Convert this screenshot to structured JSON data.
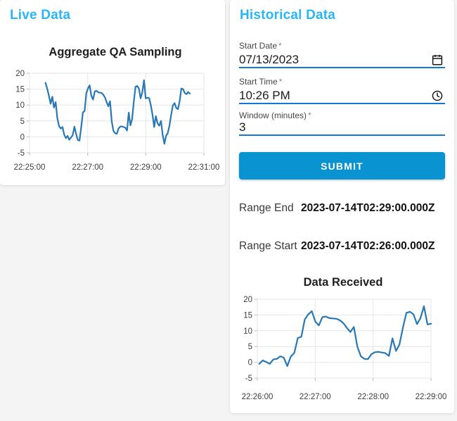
{
  "theme": {
    "accent_blue": "#29b6f6",
    "submit_blue": "#0994d1",
    "underline_blue": "#1079d8",
    "line_blue": "#2878b5"
  },
  "live_panel": {
    "title": "Live Data"
  },
  "historical_panel": {
    "title": "Historical Data",
    "form": {
      "required_marker": "*",
      "start_date": {
        "label": "Start Date",
        "value": "07/13/2023",
        "icon": "calendar-icon"
      },
      "start_time": {
        "label": "Start Time",
        "value": "10:26 PM",
        "icon": "clock-icon"
      },
      "window_minutes": {
        "label": "Window (minutes)",
        "value": "3"
      },
      "submit_label": "SUBMIT"
    },
    "results": {
      "range_end_label": "Range End",
      "range_end_value": "2023-07-14T02:29:00.000Z",
      "range_start_label": "Range Start",
      "range_start_value": "2023-07-14T02:26:00.000Z"
    }
  },
  "chart_data": [
    {
      "type": "line",
      "title": "Aggregate QA Sampling",
      "x_tick_labels": [
        "22:25:00",
        "22:27:00",
        "22:29:00",
        "22:31:00"
      ],
      "x_axis_seconds": 360,
      "data_start_seconds": 33,
      "data_end_seconds": 331,
      "ylim": [
        -5,
        20
      ],
      "y_ticks": [
        20,
        15,
        10,
        5,
        0,
        -5
      ],
      "grid": true,
      "legend": "none",
      "line_color": "#2878b5",
      "values": [
        17.0,
        15.2,
        12.9,
        10.4,
        12.6,
        9.2,
        10.9,
        5.8,
        3.3,
        2.6,
        3.1,
        0.7,
        -0.4,
        0.3,
        -0.9,
        -0.2,
        0.5,
        3.2,
        1.0,
        -1.0,
        -1.2,
        3.0,
        7.7,
        8.1,
        13.6,
        15.2,
        16.2,
        12.9,
        11.7,
        14.3,
        14.5,
        14.0,
        13.9,
        13.8,
        13.3,
        12.4,
        10.9,
        9.6,
        11.2,
        4.9,
        1.9,
        1.1,
        1.0,
        2.6,
        3.2,
        3.3,
        3.1,
        2.9,
        2.0,
        7.6,
        3.6,
        5.6,
        11.0,
        15.7,
        16.0,
        15.2,
        12.1,
        14.0,
        17.8,
        12.1,
        12.3,
        12.2,
        10.0,
        7.0,
        3.1,
        6.5,
        4.3,
        3.5,
        5.0,
        0.6,
        -2.2,
        0.3,
        1.2,
        3.5,
        7.0,
        9.9,
        10.6,
        9.1,
        8.7,
        11.2,
        15.2,
        15.0,
        13.8,
        13.4,
        14.1,
        13.6
      ]
    },
    {
      "type": "line",
      "title": "Data Received",
      "x_tick_labels": [
        "22:26:00",
        "22:27:00",
        "22:28:00",
        "22:29:00"
      ],
      "x_axis_seconds": 180,
      "data_start_seconds": 2,
      "data_end_seconds": 180,
      "ylim": [
        -5,
        20
      ],
      "y_ticks": [
        20,
        15,
        10,
        5,
        0,
        -5
      ],
      "grid": true,
      "legend": "none",
      "line_color": "#2878b5",
      "values": [
        -0.5,
        0.6,
        0.1,
        -0.5,
        0.9,
        1.1,
        1.9,
        1.5,
        -1.2,
        1.8,
        3.0,
        7.7,
        8.1,
        13.6,
        15.2,
        16.2,
        12.9,
        11.7,
        14.3,
        14.5,
        14.0,
        13.9,
        13.8,
        13.3,
        12.4,
        10.9,
        9.6,
        11.2,
        4.9,
        1.9,
        1.1,
        1.0,
        2.6,
        3.2,
        3.3,
        3.1,
        2.9,
        2.0,
        7.6,
        3.6,
        5.6,
        11.0,
        15.7,
        16.0,
        15.2,
        12.1,
        14.0,
        17.8,
        12.0,
        12.2
      ]
    }
  ]
}
